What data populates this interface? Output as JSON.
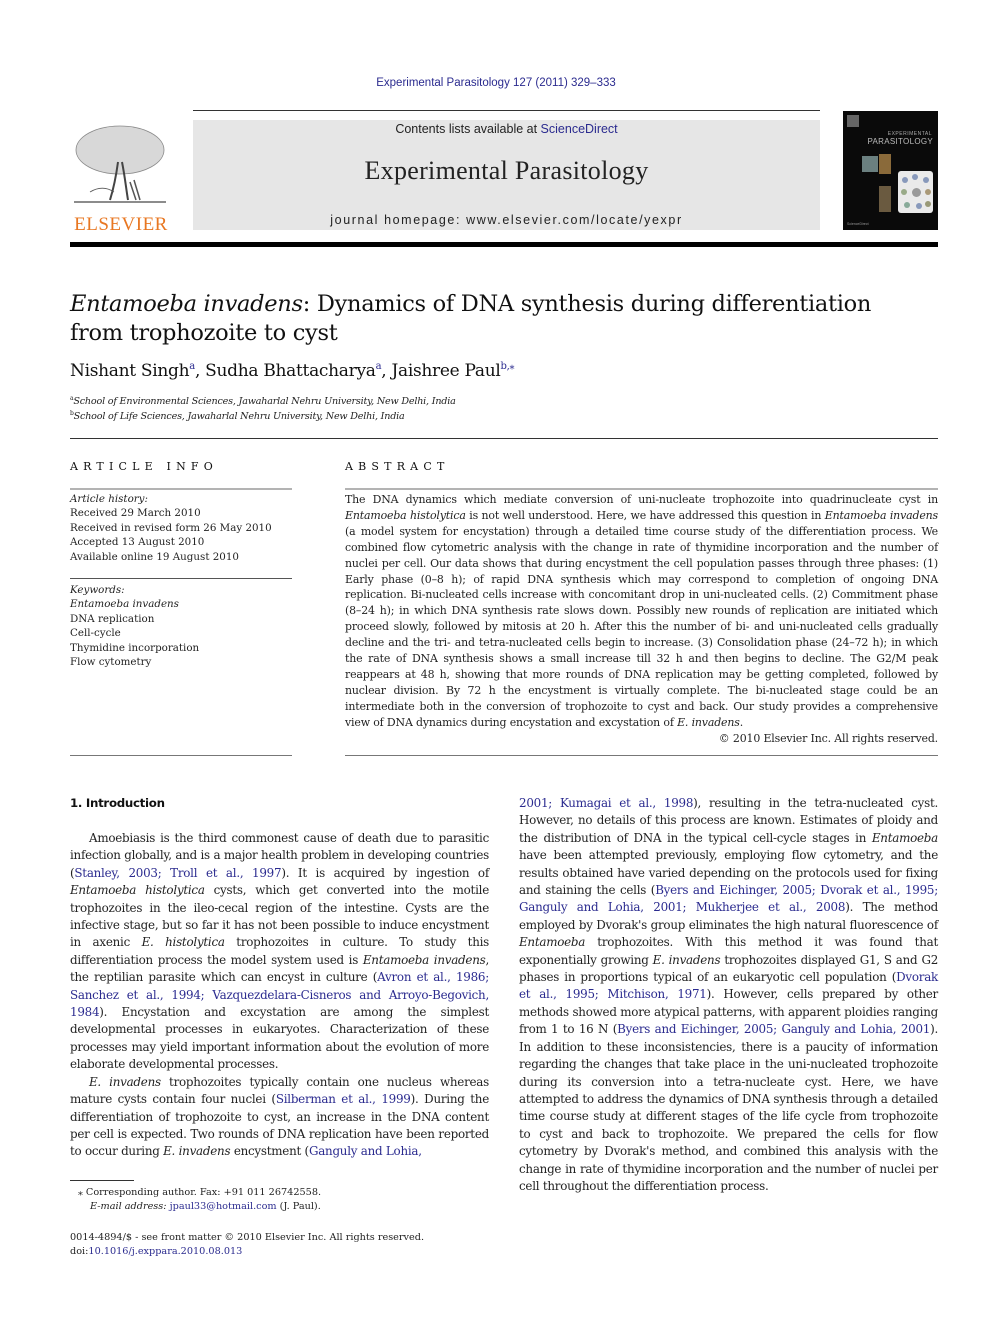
{
  "running_head": "Experimental Parasitology 127 (2011) 329–333",
  "masthead": {
    "publisher_name": "ELSEVIER",
    "contents_prefix": "Contents lists available at ",
    "contents_link": "ScienceDirect",
    "journal_name": "Experimental Parasitology",
    "homepage_line": "journal homepage: www.elsevier.com/locate/yexpr",
    "cover": {
      "title_small": "EXPERIMENTAL",
      "title_large": "PARASITOLOGY",
      "footer": "ScienceDirect"
    }
  },
  "article": {
    "title_italic": "Entamoeba invadens",
    "title_rest": ": Dynamics of DNA synthesis during differentiation from trophozoite to cyst",
    "authors": [
      {
        "name": "Nishant Singh",
        "sup": "a"
      },
      {
        "name": "Sudha Bhattacharya",
        "sup": "a"
      },
      {
        "name": "Jaishree Paul",
        "sup": "b,⁎"
      }
    ],
    "affiliations": [
      {
        "key": "a",
        "text": "School of Environmental Sciences, Jawaharlal Nehru University, New Delhi, India"
      },
      {
        "key": "b",
        "text": "School of Life Sciences, Jawaharlal Nehru University, New Delhi, India"
      }
    ]
  },
  "article_info": {
    "heading": "ARTICLE INFO",
    "history_label": "Article history:",
    "history": [
      "Received 29 March 2010",
      "Received in revised form 26 May 2010",
      "Accepted 13 August 2010",
      "Available online 19 August 2010"
    ],
    "keywords_label": "Keywords:",
    "keywords": [
      "Entamoeba invadens",
      "DNA replication",
      "Cell-cycle",
      "Thymidine incorporation",
      "Flow cytometry"
    ]
  },
  "abstract": {
    "heading": "ABSTRACT",
    "segments": [
      {
        "t": "The DNA dynamics which mediate conversion of uni-nucleate trophozoite into quadrinucleate cyst in "
      },
      {
        "t": "Entamoeba histolytica",
        "i": true
      },
      {
        "t": " is not well understood. Here, we have addressed this question in "
      },
      {
        "t": "Entamoeba invadens",
        "i": true
      },
      {
        "t": " (a model system for encystation) through a detailed time course study of the differentiation process. We combined flow cytometric analysis with the change in rate of thymidine incorporation and the number of nuclei per cell. Our data shows that during encystment the cell population passes through three phases: (1) Early phase (0–8 h); of rapid DNA synthesis which may correspond to completion of ongoing DNA replication. Bi-nucleated cells increase with concomitant drop in uni-nucleated cells. (2) Commitment phase (8–24 h); in which DNA synthesis rate slows down. Possibly new rounds of replication are initiated which proceed slowly, followed by mitosis at 20 h. After this the number of bi- and uni-nucleated cells gradually decline and the tri- and tetra-nucleated cells begin to increase. (3) Consolidation phase (24–72 h); in which the rate of DNA synthesis shows a small increase till 32 h and then begins to decline. The G2/M peak reappears at 48 h, showing that more rounds of DNA replication may be getting completed, followed by nuclear division. By 72 h the encystment is virtually complete. The bi-nucleated stage could be an intermediate both in the conversion of trophozoite to cyst and back. Our study provides a comprehensive view of DNA dynamics during encystation and excystation of "
      },
      {
        "t": "E. invadens",
        "i": true
      },
      {
        "t": "."
      }
    ],
    "copyright": "© 2010 Elsevier Inc. All rights reserved."
  },
  "intro": {
    "heading": "1. Introduction",
    "left_paragraphs": [
      [
        {
          "t": "Amoebiasis is the third commonest cause of death due to parasitic infection globally, and is a major health problem in developing countries ("
        },
        {
          "t": "Stanley, 2003; Troll et al., 1997",
          "link": true
        },
        {
          "t": "). It is acquired by ingestion of "
        },
        {
          "t": "Entamoeba histolytica",
          "i": true
        },
        {
          "t": " cysts, which get converted into the motile trophozoites in the ileo-cecal region of the intestine. Cysts are the infective stage, but so far it has not been possible to induce encystment in axenic "
        },
        {
          "t": "E. histolytica",
          "i": true
        },
        {
          "t": " trophozoites in culture. To study this differentiation process the model system used is "
        },
        {
          "t": "Entamoeba invadens",
          "i": true
        },
        {
          "t": ", the reptilian parasite which can encyst in culture ("
        },
        {
          "t": "Avron et al., 1986; Sanchez et al., 1994; Vazquezdelara-Cisneros and Arroyo-Begovich, 1984",
          "link": true
        },
        {
          "t": "). Encystation and excystation are among the simplest developmental processes in eukaryotes. Characterization of these processes may yield important information about the evolution of more elaborate developmental processes."
        }
      ],
      [
        {
          "t": "E. invadens",
          "i": true
        },
        {
          "t": " trophozoites typically contain one nucleus whereas mature cysts contain four nuclei ("
        },
        {
          "t": "Silberman et al., 1999",
          "link": true
        },
        {
          "t": "). During the differentiation of trophozoite to cyst, an increase in the DNA content per cell is expected. Two rounds of DNA replication have been reported to occur during "
        },
        {
          "t": "E. invadens",
          "i": true
        },
        {
          "t": " encystment ("
        },
        {
          "t": "Ganguly and Lohia,",
          "link": true
        }
      ]
    ],
    "right_paragraphs": [
      [
        {
          "t": "2001; Kumagai et al., 1998",
          "link": true
        },
        {
          "t": "), resulting in the tetra-nucleated cyst. However, no details of this process are known. Estimates of ploidy and the distribution of DNA in the typical cell-cycle stages in "
        },
        {
          "t": "Entamoeba",
          "i": true
        },
        {
          "t": " have been attempted previously, employing flow cytometry, and the results obtained have varied depending on the protocols used for fixing and staining the cells ("
        },
        {
          "t": "Byers and Eichinger, 2005; Dvorak et al., 1995; Ganguly and Lohia, 2001; Mukherjee et al., 2008",
          "link": true
        },
        {
          "t": "). The method employed by Dvorak's group eliminates the high natural fluorescence of "
        },
        {
          "t": "Entamoeba",
          "i": true
        },
        {
          "t": " trophozoites. With this method it was found that exponentially growing "
        },
        {
          "t": "E. invadens",
          "i": true
        },
        {
          "t": " trophozoites displayed G1, S and G2 phases in proportions typical of an eukaryotic cell population ("
        },
        {
          "t": "Dvorak et al., 1995; Mitchison, 1971",
          "link": true
        },
        {
          "t": "). However, cells prepared by other methods showed more atypical patterns, with apparent ploidies ranging from 1 to 16 N ("
        },
        {
          "t": "Byers and Eichinger, 2005; Ganguly and Lohia, 2001",
          "link": true
        },
        {
          "t": "). In addition to these inconsistencies, there is a paucity of information regarding the changes that take place in the uni-nucleated trophozoite during its conversion into a tetra-nucleate cyst. Here, we have attempted to address the dynamics of DNA synthesis through a detailed time course study at different stages of the life cycle from trophozoite to cyst and back to trophozoite. We prepared the cells for flow cytometry by Dvorak's method, and combined this analysis with the change in rate of thymidine incorporation and the number of nuclei per cell throughout the differentiation process."
        }
      ]
    ]
  },
  "footnotes": {
    "corresponding_marker": "⁎",
    "corresponding_text": " Corresponding author. Fax: +91 011 26742558.",
    "email_label": "E-mail address:",
    "email": "jpaul33@hotmail.com",
    "email_suffix": " (J. Paul).",
    "issn_line": "0014-4894/$ - see front matter © 2010 Elsevier Inc. All rights reserved.",
    "doi_prefix": "doi:",
    "doi": "10.1016/j.exppara.2010.08.013"
  },
  "colors": {
    "link": "#2b2b8f",
    "elsevier_orange": "#e87722",
    "masthead_bg": "#e6e6e6"
  }
}
